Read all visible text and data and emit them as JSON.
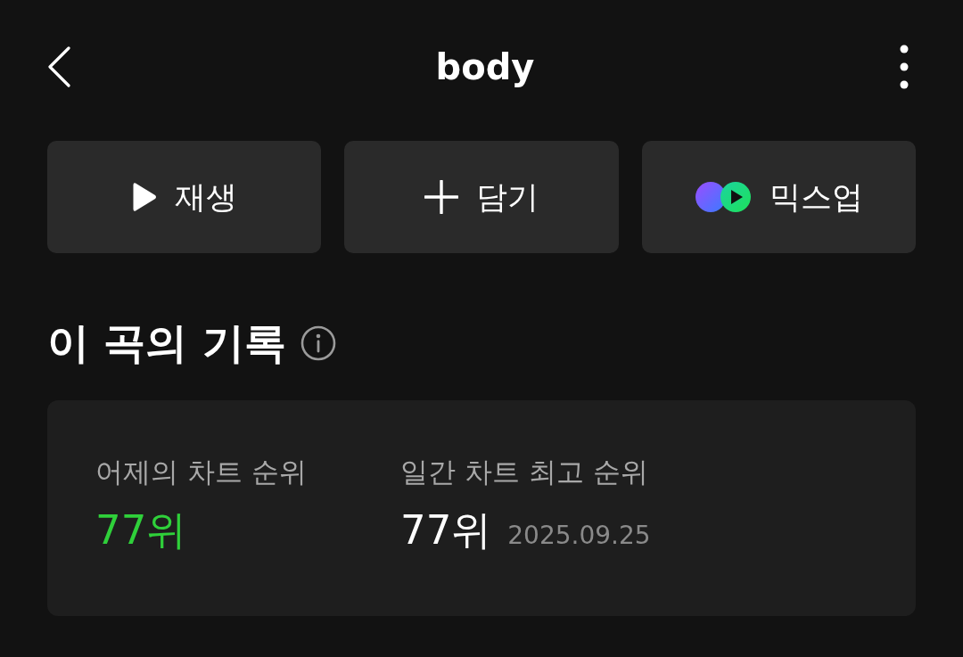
{
  "header": {
    "title": "body"
  },
  "actions": [
    {
      "kind": "play",
      "label": "재생"
    },
    {
      "kind": "add",
      "label": "담기"
    },
    {
      "kind": "mixup",
      "label": "믹스업"
    }
  ],
  "section": {
    "title": "이 곡의 기록"
  },
  "stats": [
    {
      "label": "어제의 차트 순위",
      "value": "77위",
      "color": "#2fd03a"
    },
    {
      "label": "일간 차트 최고 순위",
      "value": "77위",
      "color": "#ffffff",
      "date": "2025.09.25"
    }
  ]
}
